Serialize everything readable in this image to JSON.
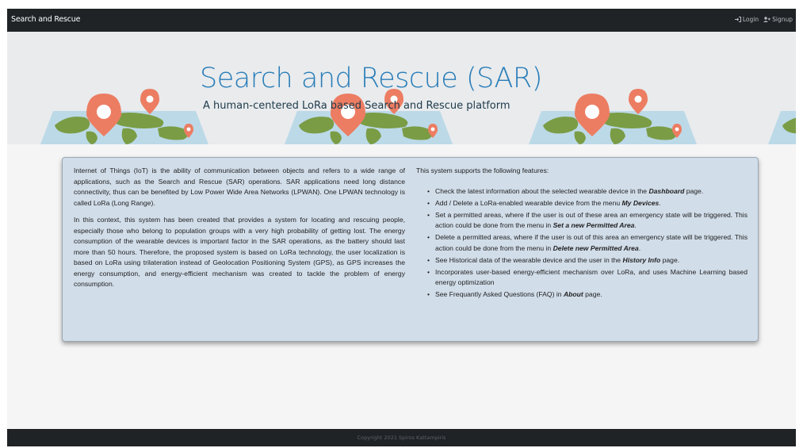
{
  "navbar": {
    "brand": "Search and Rescue",
    "login_label": "Login",
    "signup_label": "Signup"
  },
  "banner": {
    "title": "Search and Rescue (SAR)",
    "subtitle": "A human-centered LoRa based Search and Rescue platform"
  },
  "intro": {
    "paragraph1": "Internet of Things (IoT) is the ability of communication between objects and refers to a wide range of applications, such as the Search and Rescue (SAR) operations. SAR applications need long distance connectivity, thus can be benefited by Low Power Wide Area Networks (LPWAN). One LPWAN technology is called LoRa (Long Range).",
    "paragraph2": "In this context, this system has been created that provides a system for locating and rescuing people, especially those who belong to population groups with a very high probability of getting lost. The energy consumption of the wearable devices is important factor in the SAR operations, as the battery should last more than 50 hours. Therefore, the proposed system is based on LoRa technology, the user localization is based on LoRa using trilateration instead of Geolocation Positioning System (GPS), as GPS increases the energy consumption, and energy-efficient mechanism was created to tackle the problem of energy consumption."
  },
  "features": {
    "heading": "This system supports the following features:",
    "items": [
      {
        "before": "Check the latest information about the selected wearable device in the ",
        "bold": "Dashboard",
        "after": " page."
      },
      {
        "before": "Add / Delete a LoRa-enabled wearable device from the menu ",
        "bold": "My Devices",
        "after": "."
      },
      {
        "before": "Set a permitted areas, where if the user is out of these area an emergency state will be triggered. This action could be done from the menu in ",
        "bold": "Set a new Permitted Area",
        "after": "."
      },
      {
        "before": "Delete a permitted areas, where if the user is out of this area an emergency state will be triggered. This action could be done from the menu in ",
        "bold": "Delete new Permitted Area",
        "after": "."
      },
      {
        "before": "See Historical data of the wearable device and the user in the ",
        "bold": "History Info",
        "after": " page."
      },
      {
        "before": "Incorporates user-based energy-efficient mechanism over LoRa, and uses Machine Learning based energy optimization",
        "bold": "",
        "after": ""
      },
      {
        "before": "See Frequantly Asked Questions (FAQ) in ",
        "bold": "About",
        "after": " page."
      }
    ]
  },
  "footer": {
    "copyright": "Copyright 2021 Spiros Kattampiris"
  },
  "colors": {
    "navbar": "#1f2326",
    "title_accent": "#2a7db8",
    "panel_bg": "#d1dde9",
    "map_land": "#7a9c45",
    "map_water": "#bcd9e8",
    "pin": "#ec7d62"
  },
  "icons": {
    "login": "sign-in-icon",
    "signup": "user-plus-icon",
    "map": "world-map-icon",
    "pin": "map-pin-icon"
  }
}
